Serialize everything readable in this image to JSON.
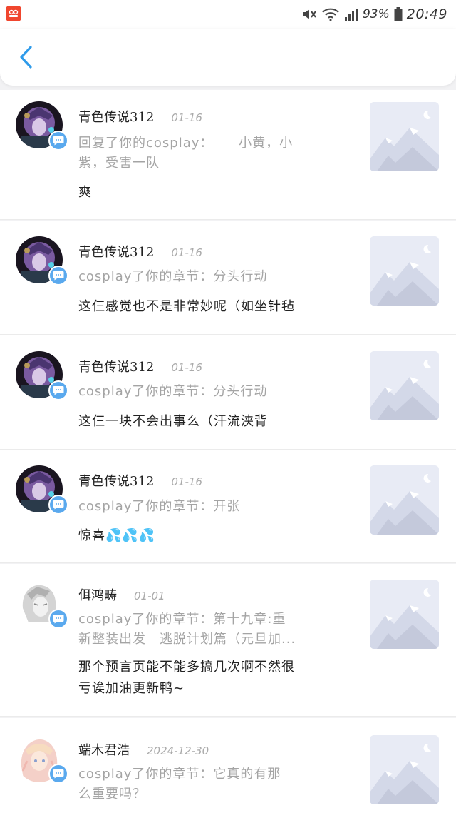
{
  "status_bar": {
    "battery_percent": "93%",
    "time": "20:49",
    "icons": [
      "app-icon",
      "mute-icon",
      "wifi-icon",
      "signal-icon",
      "battery-icon"
    ]
  },
  "header": {
    "back_icon": "chevron-left-icon"
  },
  "colors": {
    "accent": "#2f9bea",
    "badge": "#5aa9ee",
    "muted_text": "#a4a4a4",
    "thumb_bg": "#e8ebf5"
  },
  "items": [
    {
      "name": "青色传说312",
      "date": "01-16",
      "quote_lines": [
        "回复了你的cosplay：　　 小黄，小",
        "紫，受害一队"
      ],
      "reply_lines": [
        "爽"
      ],
      "avatar": "purple"
    },
    {
      "name": "青色传说312",
      "date": "01-16",
      "quote_lines": [
        "cosplay了你的章节：分头行动"
      ],
      "reply_lines": [
        "这仨感觉也不是非常妙呢（如坐针毡"
      ],
      "avatar": "purple"
    },
    {
      "name": "青色传说312",
      "date": "01-16",
      "quote_lines": [
        "cosplay了你的章节：分头行动"
      ],
      "reply_lines": [
        "这仨一块不会出事么（汗流浃背"
      ],
      "avatar": "purple"
    },
    {
      "name": "青色传说312",
      "date": "01-16",
      "quote_lines": [
        "cosplay了你的章节：开张"
      ],
      "reply_lines": [
        "惊喜💦💦💦"
      ],
      "avatar": "purple"
    },
    {
      "name": "佴鸿畴",
      "date": "01-01",
      "quote_lines": [
        "cosplay了你的章节：第十九章:重",
        "新整装出发　逃脱计划篇（元旦加..."
      ],
      "reply_lines": [
        "那个预言页能不能多搞几次啊不然很",
        "亏诶加油更新鸭~"
      ],
      "avatar": "gray"
    },
    {
      "name": "端木君浩",
      "date": "2024-12-30",
      "quote_lines": [
        "cosplay了你的章节：它真的有那",
        "么重要吗？"
      ],
      "reply_lines": [],
      "avatar": "pink"
    }
  ]
}
